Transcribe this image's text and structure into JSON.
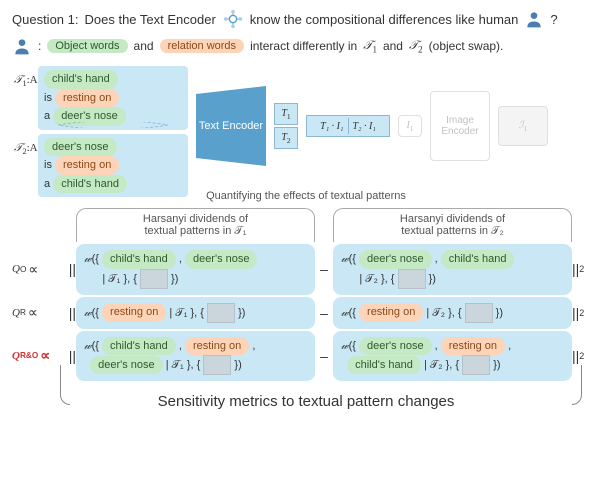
{
  "header": {
    "question_label": "Question 1:",
    "question_text_a": "Does the Text Encoder",
    "question_text_b": "know the compositional differences like human",
    "question_end": "?"
  },
  "subheader": {
    "colon": ":",
    "obj_words": "Object words",
    "and": "and",
    "rel_words": "relation words",
    "interact": "interact differently in",
    "t1": "𝒯",
    "t1_sub": "1",
    "and2": "and",
    "t2": "𝒯",
    "t2_sub": "2",
    "swap": "(object swap)."
  },
  "inputs": {
    "t1": {
      "label": "𝒯",
      "label_sub": "1",
      "prefix": ":A",
      "w1": "child's hand",
      "is": "is",
      "w2": "resting on",
      "a": "a",
      "w3": "deer's nose"
    },
    "t2": {
      "label": "𝒯",
      "label_sub": "2",
      "prefix": ":A",
      "w1": "deer's nose",
      "is": "is",
      "w2": "resting on",
      "a": "a",
      "w3": "child's hand"
    }
  },
  "encoder": {
    "text_encoder": "Text Encoder",
    "image_encoder": "Image Encoder"
  },
  "embeds": {
    "T1": "T",
    "T1s": "1",
    "T2": "T",
    "T2s": "2",
    "I1": "I",
    "I1s": "1",
    "dot1": "T₁ · I₁",
    "dot2": "T₂ · I₁"
  },
  "quantify": "Quantifying the effects of textual patterns",
  "col_headers": {
    "left_a": "Harsanyi dividends of",
    "left_b": "textual patterns in 𝒯₁",
    "right_a": "Harsanyi dividends of",
    "right_b": "textual patterns in 𝒯₂"
  },
  "rows": {
    "qo": {
      "label": "Q",
      "label_sub": "O",
      "fn": "𝓌",
      "l_w1": "child's hand",
      "l_w2": "deer's nose",
      "l_ctx": "| 𝒯₁ }, {",
      "r_w1": "deer's nose",
      "r_w2": "child's hand",
      "r_ctx": "| 𝒯₂ }, {"
    },
    "qr": {
      "label": "Q",
      "label_sub": "R",
      "fn": "𝓌",
      "l_w1": "resting on",
      "l_ctx": "| 𝒯₁ }, {",
      "r_w1": "resting on",
      "r_ctx": "| 𝒯₂ }, {"
    },
    "qro": {
      "label": "Q",
      "label_sub": "R&O",
      "fn": "𝓌",
      "l_w1": "child's hand",
      "l_w2": "resting on",
      "l_w3": "deer's nose",
      "l_ctx": "| 𝒯₁ }, {",
      "r_w1": "deer's nose",
      "r_w2": "resting on",
      "r_w3": "child's hand",
      "r_ctx": "| 𝒯₂ }, {"
    }
  },
  "footer": "Sensitivity metrics to textual pattern changes",
  "symbols": {
    "prop": "∝",
    "norm": "||",
    "minus": "–",
    "sq": "2",
    "close": "})"
  }
}
